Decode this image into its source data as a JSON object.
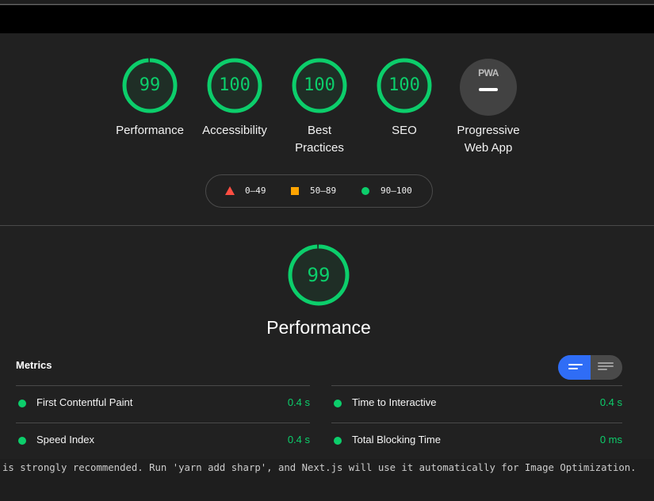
{
  "categories": [
    {
      "name": "performance",
      "score": "99",
      "label": "Performance"
    },
    {
      "name": "accessibility",
      "score": "100",
      "label": "Accessibility"
    },
    {
      "name": "best-practices",
      "score": "100",
      "label": "Best Practices"
    },
    {
      "name": "seo",
      "score": "100",
      "label": "SEO"
    },
    {
      "name": "pwa",
      "badge": "PWA",
      "label": "Progressive Web App"
    }
  ],
  "legend": {
    "fail": "0–49",
    "average": "50–89",
    "pass": "90–100"
  },
  "section": {
    "score": "99",
    "title": "Performance",
    "metrics_heading": "Metrics"
  },
  "metrics": [
    {
      "label": "First Contentful Paint",
      "value": "0.4 s"
    },
    {
      "label": "Time to Interactive",
      "value": "0.4 s"
    },
    {
      "label": "Speed Index",
      "value": "0.4 s"
    },
    {
      "label": "Total Blocking Time",
      "value": "0 ms"
    }
  ],
  "console": {
    "line": "is strongly recommended. Run 'yarn add sharp', and Next.js will use it automatically for Image Optimization."
  },
  "colors": {
    "pass": "#0cce6b",
    "average": "#ffa400",
    "fail": "#ff4e42",
    "toggle_active": "#2f6df6",
    "background": "#212121"
  },
  "icons": {
    "fail": "triangle-icon",
    "average": "square-icon",
    "pass": "circle-icon",
    "view_toggle": [
      "list-expanded-icon",
      "list-compact-icon"
    ]
  }
}
